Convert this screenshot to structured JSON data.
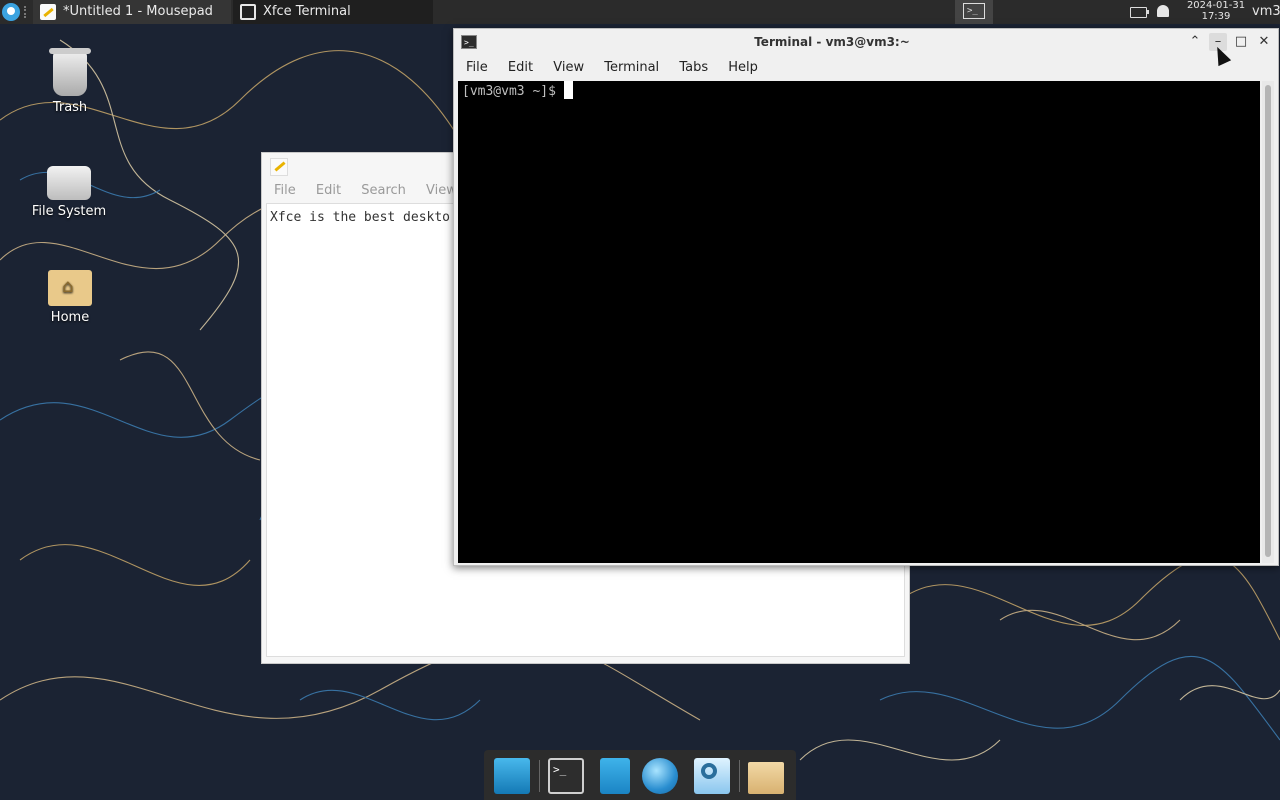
{
  "panel": {
    "tasks": [
      {
        "label": "*Untitled 1 - Mousepad",
        "icon": "mousepad-icon"
      },
      {
        "label": "Xfce Terminal",
        "icon": "terminal-icon"
      }
    ],
    "clock_date": "2024-01-31",
    "clock_time": "17:39",
    "user": "vm3",
    "workspace_label": ">_"
  },
  "desktop": {
    "icons": [
      {
        "label": "Trash",
        "icon": "trash-icon"
      },
      {
        "label": "File System",
        "icon": "drive-icon"
      },
      {
        "label": "Home",
        "icon": "home-folder-icon"
      }
    ]
  },
  "mousepad": {
    "menu": [
      "File",
      "Edit",
      "Search",
      "View"
    ],
    "content": "Xfce is the best deskto"
  },
  "terminal": {
    "title": "Terminal - vm3@vm3:~",
    "menu": [
      "File",
      "Edit",
      "View",
      "Terminal",
      "Tabs",
      "Help"
    ],
    "prompt": "[vm3@vm3 ~]$",
    "buttons": {
      "up": "⌃",
      "minimize": "–",
      "maximize": "□",
      "close": "✕"
    }
  },
  "dock": {
    "items": [
      "show-desktop",
      "terminal",
      "file-manager",
      "web-browser",
      "app-finder",
      "home-folder"
    ],
    "terminal_glyph": ">_"
  },
  "colors": {
    "panel": "#2b2b2b",
    "accent": "#3ba3e0",
    "terminal_bg": "#000000"
  }
}
